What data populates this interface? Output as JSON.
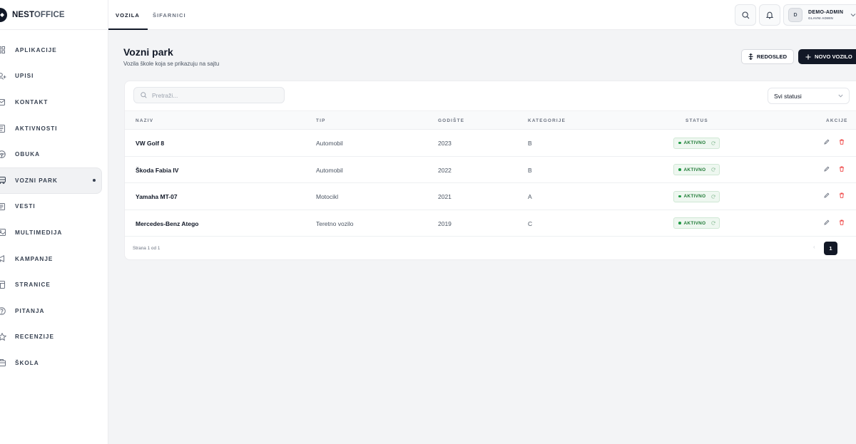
{
  "brand": {
    "name_bold": "NEST",
    "name_rest": "OFFICE"
  },
  "sidebar": {
    "items": [
      {
        "label": "APLIKACIJE",
        "icon": "grid-icon"
      },
      {
        "label": "UPISI",
        "icon": "user-plus-icon"
      },
      {
        "label": "KONTAKT",
        "icon": "mail-icon"
      },
      {
        "label": "AKTIVNOSTI",
        "icon": "list-icon"
      },
      {
        "label": "OBUKA",
        "icon": "steering-icon"
      },
      {
        "label": "VOZNI PARK",
        "icon": "car-icon",
        "active": true
      },
      {
        "label": "VESTI",
        "icon": "news-icon"
      },
      {
        "label": "MULTIMEDIJA",
        "icon": "image-icon"
      },
      {
        "label": "KAMPANJE",
        "icon": "megaphone-icon"
      },
      {
        "label": "STRANICE",
        "icon": "page-icon"
      },
      {
        "label": "PITANJA",
        "icon": "question-icon"
      },
      {
        "label": "RECENZIJE",
        "icon": "star-icon"
      },
      {
        "label": "ŠKOLA",
        "icon": "building-icon"
      }
    ]
  },
  "topbar": {
    "tabs": [
      {
        "label": "VOZILA",
        "active": true
      },
      {
        "label": "ŠIFARNICI"
      }
    ],
    "user": {
      "initial": "D",
      "name": "DEMO-ADMIN",
      "role": "GLAVNI ADMIN"
    }
  },
  "header": {
    "title": "Vozni park",
    "subtitle": "Vozila škole koja se prikazuju na sajtu",
    "reorder_label": "REDOSLED",
    "add_label": "NOVO VOZILO"
  },
  "filters": {
    "search_placeholder": "Pretraži...",
    "status_select": "Svi statusi"
  },
  "table": {
    "columns": {
      "name": "NAZIV",
      "type": "TIP",
      "year": "GODIŠTE",
      "category": "KATEGORIJE",
      "status": "STATUS",
      "actions": "AKCIJE"
    },
    "rows": [
      {
        "name": "VW Golf 8",
        "type": "Automobil",
        "year": "2023",
        "category": "B",
        "status": "AKTIVNO"
      },
      {
        "name": "Škoda Fabia IV",
        "type": "Automobil",
        "year": "2022",
        "category": "B",
        "status": "AKTIVNO"
      },
      {
        "name": "Yamaha MT-07",
        "type": "Motocikl",
        "year": "2021",
        "category": "A",
        "status": "AKTIVNO"
      },
      {
        "name": "Mercedes-Benz Atego",
        "type": "Teretno vozilo",
        "year": "2019",
        "category": "C",
        "status": "AKTIVNO"
      }
    ]
  },
  "pagination": {
    "text": "Strana 1 od 1",
    "current": "1",
    "prev": "‹"
  },
  "colors": {
    "accent_dark": "#121826",
    "status_green": "#1f7a36",
    "delete_red": "#ef4444"
  }
}
